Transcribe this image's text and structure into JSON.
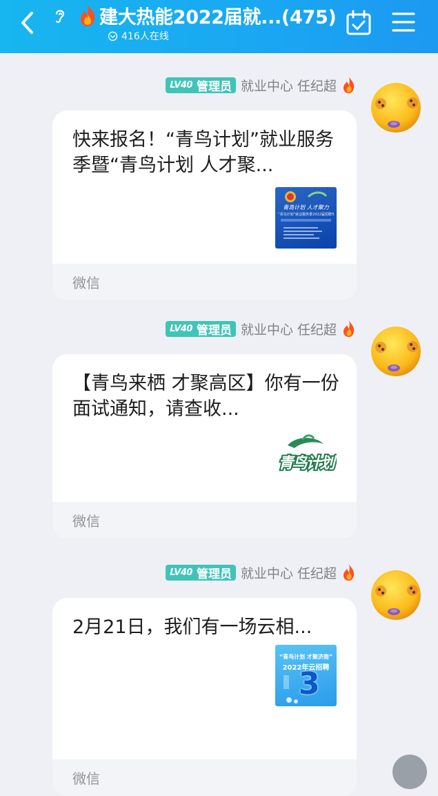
{
  "header": {
    "title": "建大热能2022届就...(475)",
    "online": "416人在线"
  },
  "messages": [
    {
      "badge_level": "LV40",
      "badge_role": "管理员",
      "sender": "就业中心 任纪超",
      "text": "快来报名！“青鸟计划”就业服务季暨“青鸟计划 人才聚...",
      "source": "微信",
      "thumb": {
        "line1": "青岛计划 人才聚力",
        "line2": "“青鸟计划”就业服务季2022届招聘专场"
      }
    },
    {
      "badge_level": "LV40",
      "badge_role": "管理员",
      "sender": "就业中心 任纪超",
      "text": "【青鸟来栖 才聚高区】你有一份面试通知，请查收...",
      "source": "微信",
      "thumb": {
        "logo_text": "青鸟计划"
      }
    },
    {
      "badge_level": "LV40",
      "badge_role": "管理员",
      "sender": "就业中心 任纪超",
      "text": "2月21日，我们有一场云相...",
      "source": "微信",
      "thumb": {
        "line1": "“青鸟计划 才聚济南”",
        "line2": "2022年云招聘",
        "number": "3"
      }
    }
  ]
}
